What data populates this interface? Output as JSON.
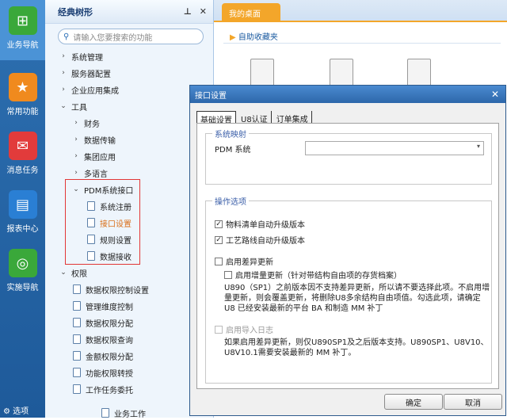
{
  "leftnav": {
    "items": [
      {
        "label": "业务导航",
        "icon": "org-chart-icon",
        "color": "#3aa83a"
      },
      {
        "label": "常用功能",
        "icon": "star-icon",
        "color": "#f08a1e"
      },
      {
        "label": "消息任务",
        "icon": "mail-icon",
        "color": "#e23b3b"
      },
      {
        "label": "报表中心",
        "icon": "report-icon",
        "color": "#2a7fd4"
      },
      {
        "label": "实施导航",
        "icon": "compass-icon",
        "color": "#3aa83a"
      }
    ],
    "settings_label": "选项"
  },
  "tree": {
    "title": "经典树形",
    "search_placeholder": "请输入您要搜索的功能",
    "rows": [
      {
        "label": "系统管理",
        "chev": "›"
      },
      {
        "label": "服务器配置",
        "chev": "›"
      },
      {
        "label": "企业应用集成",
        "chev": "›"
      },
      {
        "label": "工具",
        "chev": "⌄"
      },
      {
        "label": "财务",
        "chev": "›"
      },
      {
        "label": "数据传输",
        "chev": "›"
      },
      {
        "label": "集团应用",
        "chev": "›"
      },
      {
        "label": "多语言",
        "chev": "›"
      },
      {
        "label": "PDM系统接口",
        "chev": "⌄"
      },
      {
        "label": "系统注册"
      },
      {
        "label": "接口设置"
      },
      {
        "label": "规则设置"
      },
      {
        "label": "数据接收"
      },
      {
        "label": "权限",
        "chev": "⌄"
      },
      {
        "label": "数据权限控制设置"
      },
      {
        "label": "管理维度控制"
      },
      {
        "label": "数据权限分配"
      },
      {
        "label": "数据权限查询"
      },
      {
        "label": "金额权限分配"
      },
      {
        "label": "功能权限转授"
      },
      {
        "label": "工作任务委托"
      },
      {
        "label": "业务工作"
      }
    ]
  },
  "tabs": {
    "desktop": "我的桌面"
  },
  "desktop": {
    "fav_title": "自助收藏夹"
  },
  "dialog": {
    "title": "接口设置",
    "tabs": [
      "基础设置",
      "U8认证",
      "订单集成"
    ],
    "mapping": {
      "legend": "系统映射",
      "pdm_label": "PDM 系统",
      "pdm_value": ""
    },
    "options": {
      "legend": "操作选项",
      "bom_auto": "物料清单自动升级版本",
      "route_auto": "工艺路线自动升级版本",
      "diff_update": "启用差异更新",
      "inc_update": "启用增量更新（针对带结构自由项的存货档案）",
      "note1": "U890（SP1）之前版本因不支持差异更新，所以请不要选择此项。不启用增量更新，则会覆盖更新，将删除U8多余结构自由项值。勾选此项，请确定 U8 已经安装最新的平台 BA 和制造 MM 补丁",
      "import_log": "启用导入日志",
      "note2": "如果启用差异更新，则仅U890SP1及之后版本支持。U890SP1、U8V10、U8V10.1需要安装最新的 MM 补丁。"
    },
    "ok": "确定",
    "cancel": "取消"
  }
}
